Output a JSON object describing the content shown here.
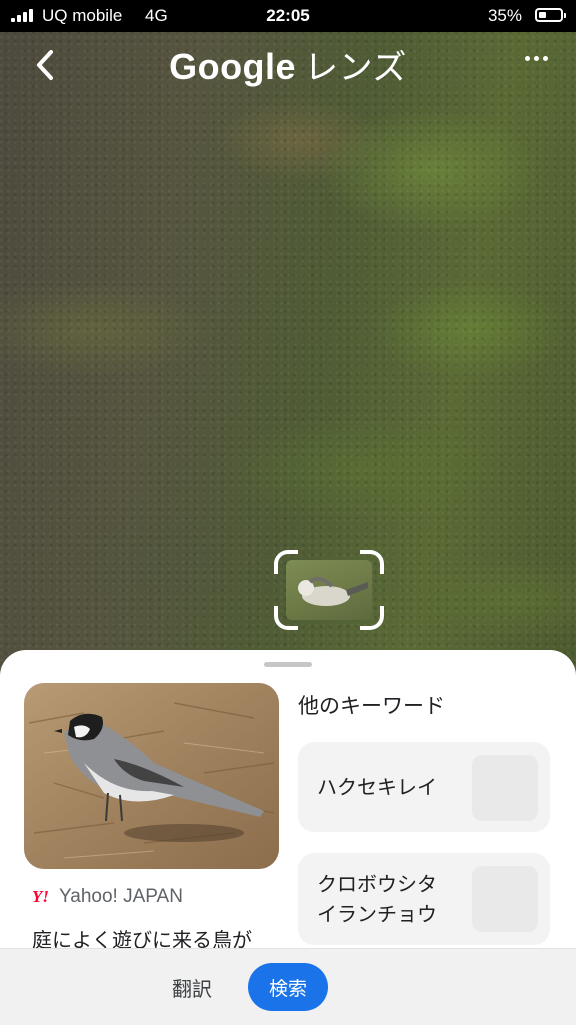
{
  "status_bar": {
    "carrier": "UQ mobile",
    "network": "4G",
    "time": "22:05",
    "battery_percent": "35%"
  },
  "app_bar": {
    "title_brand": "Google",
    "title_product": "レンズ",
    "back_icon": "chevron-left-icon",
    "menu_icon": "more-horizontal-icon"
  },
  "visual_match": {
    "source_logo": "Y!",
    "source_name": "Yahoo! JAPAN",
    "title": "庭によく遊びに来る鳥が"
  },
  "keywords": {
    "heading": "他のキーワード",
    "items": [
      {
        "label": "ハクセキレイ"
      },
      {
        "label_line1": "クロボウシタ",
        "label_line2": "イランチョウ"
      }
    ]
  },
  "actions": {
    "translate_label": "翻訳",
    "search_label": "検索",
    "active": "search"
  },
  "colors": {
    "accent": "#1a73e8",
    "yahoo": "#ff0033",
    "sheet_background": "#ffffff",
    "chip_background": "#f3f3f3"
  }
}
